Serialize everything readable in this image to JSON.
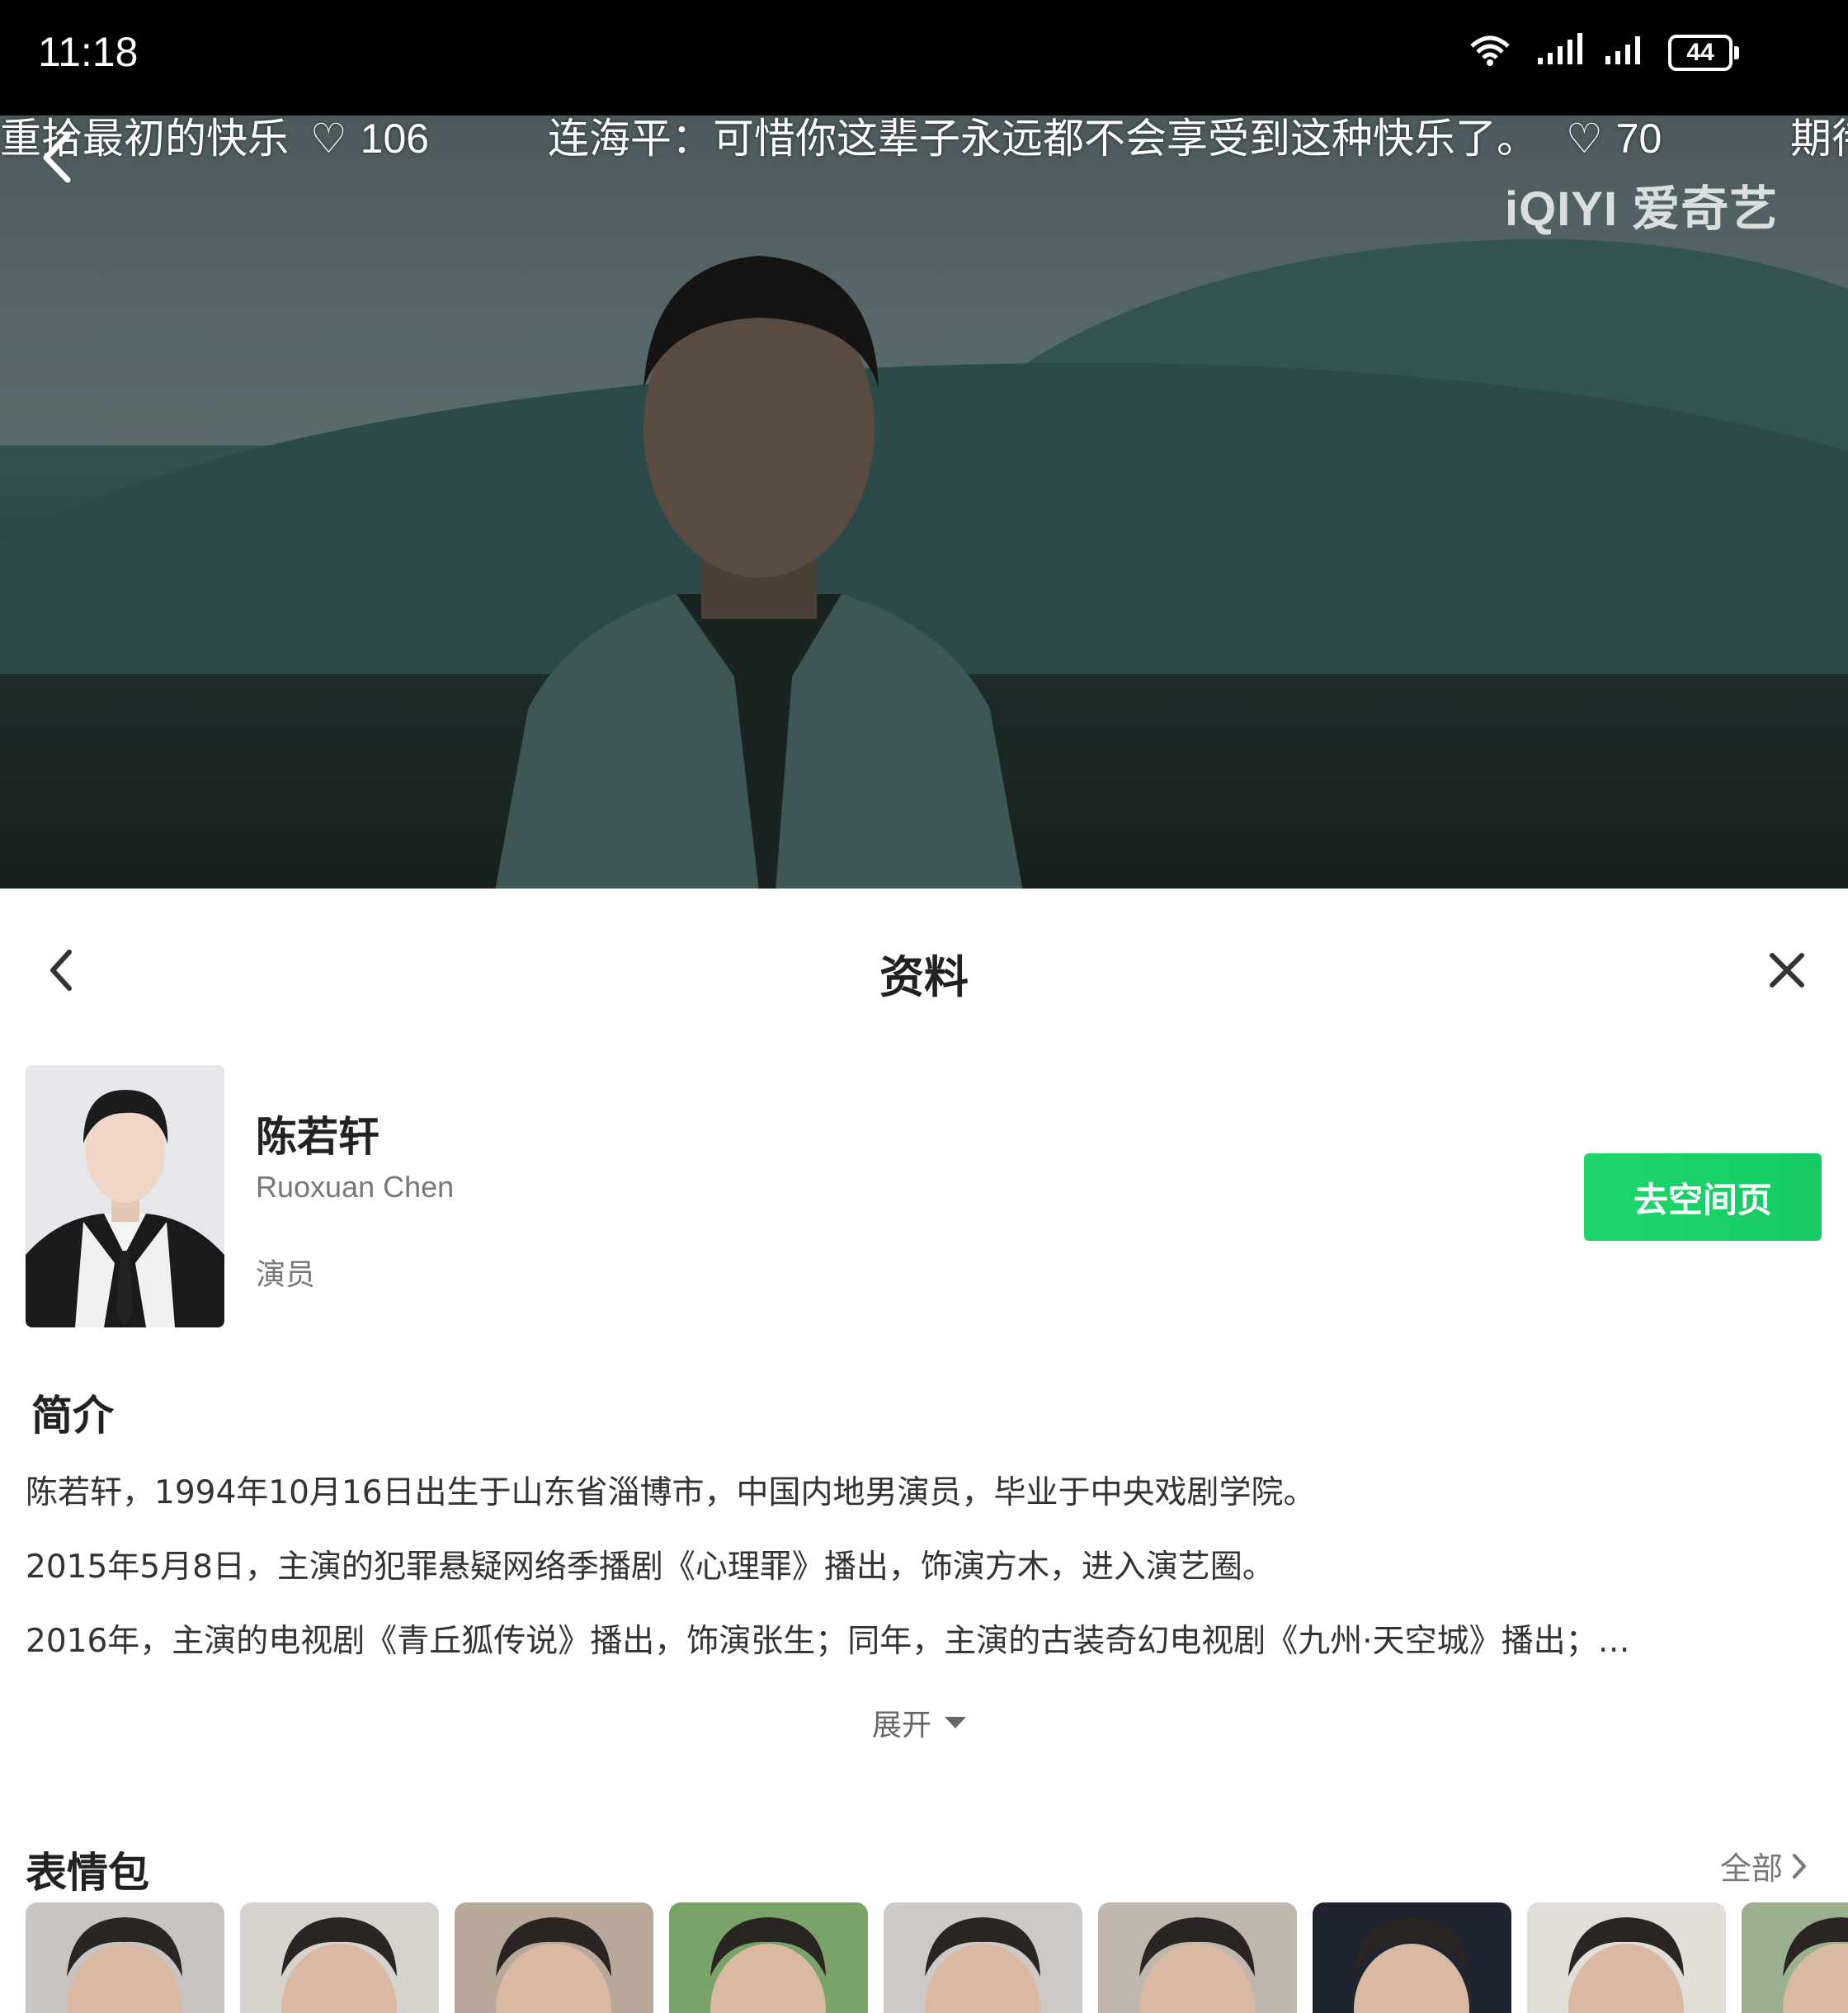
{
  "status_bar": {
    "time": "11:18",
    "battery": "44"
  },
  "video": {
    "danmaku": [
      {
        "text": "重拾最初的快乐",
        "likes": "106"
      },
      {
        "text": "连海平：可惜你这辈子永远都不会享受到这种快乐了。",
        "likes": "70"
      },
      {
        "text": "期待"
      }
    ],
    "watermark": "iQIYI 爱奇艺"
  },
  "sheet": {
    "title": "资料",
    "profile": {
      "name": "陈若轩",
      "english_name": "Ruoxuan Chen",
      "role": "演员",
      "space_button": "去空间页"
    },
    "intro": {
      "title": "简介",
      "lines": [
        "陈若轩，1994年10月16日出生于山东省淄博市，中国内地男演员，毕业于中央戏剧学院。",
        "2015年5月8日，主演的犯罪悬疑网络季播剧《心理罪》播出，饰演方木，进入演艺圈。",
        "2016年，主演的电视剧《青丘狐传说》播出，饰演张生；同年，主演的古装奇幻电视剧《九州·天空城》播出；…"
      ],
      "expand_label": "展开"
    },
    "stickers": {
      "title": "表情包",
      "all_label": "全部",
      "count": 9
    }
  },
  "colors": {
    "accent_green": "#1ed76c"
  }
}
